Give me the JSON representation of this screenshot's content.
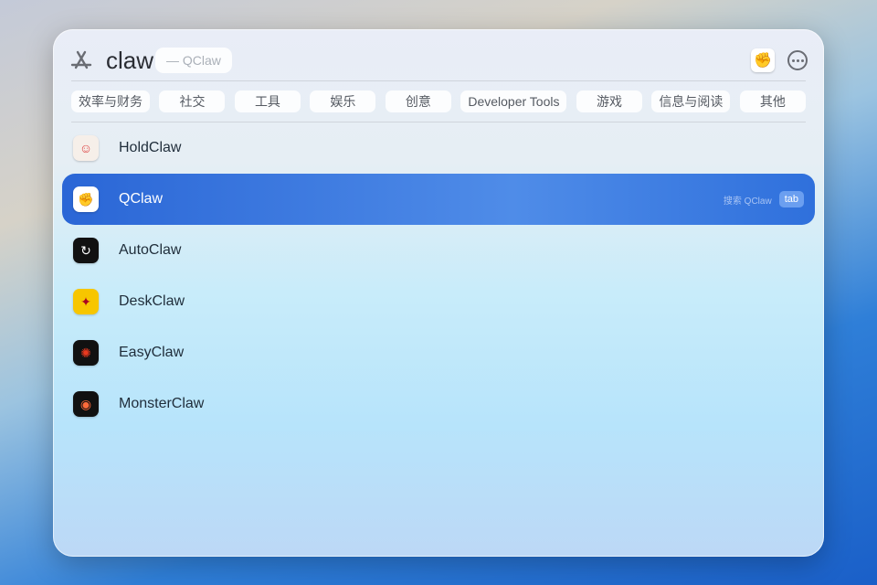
{
  "search": {
    "query": "claw",
    "suggestion": "—  QClaw"
  },
  "categories": [
    "效率与财务",
    "社交",
    "工具",
    "娱乐",
    "创意",
    "Developer Tools",
    "游戏",
    "信息与阅读",
    "其他"
  ],
  "results": [
    {
      "name": "HoldClaw",
      "icon": "holdclaw-icon"
    },
    {
      "name": "QClaw",
      "icon": "qclaw-icon",
      "selected": true,
      "hint": "搜索 QClaw",
      "key": "tab"
    },
    {
      "name": "AutoClaw",
      "icon": "autoclaw-icon"
    },
    {
      "name": "DeskClaw",
      "icon": "deskclaw-icon"
    },
    {
      "name": "EasyClaw",
      "icon": "easyclaw-icon"
    },
    {
      "name": "MonsterClaw",
      "icon": "monsterclaw-icon"
    }
  ],
  "colors": {
    "selection": "#3a78e0"
  }
}
